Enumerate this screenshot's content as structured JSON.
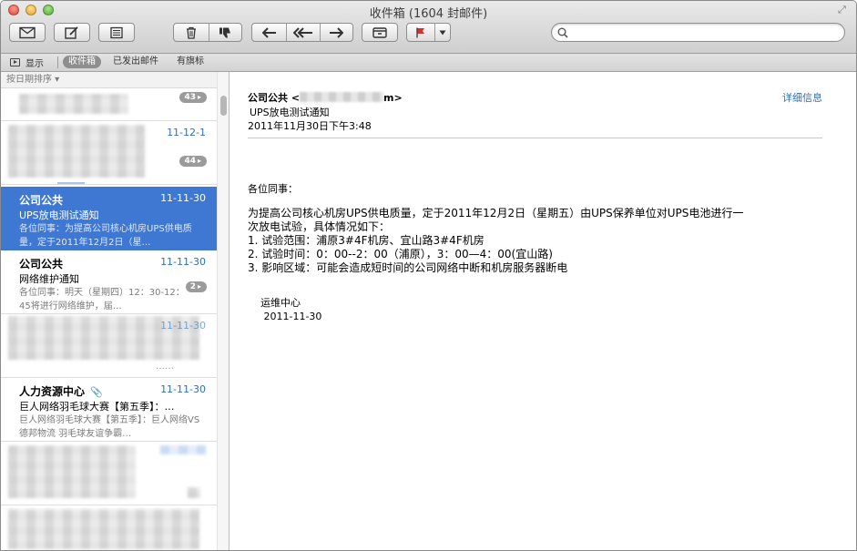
{
  "window": {
    "title": "收件箱 (1604 封邮件)"
  },
  "toolbar": {
    "search_placeholder": ""
  },
  "favorites": {
    "show_label": "显示",
    "items": [
      {
        "label": "收件箱",
        "active": true
      },
      {
        "label": "已发出邮件",
        "active": false
      },
      {
        "label": "有旗标",
        "active": false
      }
    ]
  },
  "list": {
    "sort_label": "按日期排序 ▾",
    "rows": [
      {
        "badge": "43"
      },
      {
        "date": "11-12-1",
        "badge": "44"
      },
      {
        "sender": "公司公共",
        "date": "11-11-30",
        "subject": "UPS放电测试通知",
        "preview": "各位同事：为提高公司核心机房UPS供电质量，定于2011年12月2日（星…"
      },
      {
        "sender": "公司公共",
        "date": "11-11-30",
        "subject": "网络维护通知",
        "preview": "各位同事：明天（星期四）12：30-12：45将进行网络维护，届…",
        "badge": "2"
      },
      {
        "date": "11-11-30"
      },
      {
        "sender": "人力资源中心",
        "date": "11-11-30",
        "subject": "巨人网络羽毛球大赛【第五季】：…",
        "preview": "巨人网络羽毛球大赛【第五季】：巨人网络VS德邦物流 羽毛球友谊争霸…"
      },
      {},
      {}
    ]
  },
  "message": {
    "from_name": "公司公共 <",
    "from_suffix": "m>",
    "subject": "UPS放电测试通知",
    "date": "2011年11月30日下午3:48",
    "detail_link": "详细信息",
    "greeting": "各位同事：",
    "body_lines": [
      "为提高公司核心机房UPS供电质量，定于2011年12月2日（星期五）由UPS保养单位对UPS电池进行一",
      "次放电试验，具体情况如下：",
      "1.   试验范围：浦原3#4F机房、宜山路3#4F机房",
      "2.   试验时间：0：00--2：00（浦原），3：00—4：00(宜山路)",
      "3.   影响区域：可能会造成短时间的公司网络中断和机房服务器断电"
    ],
    "signature": [
      "运维中心",
      " 2011-11-30"
    ]
  }
}
